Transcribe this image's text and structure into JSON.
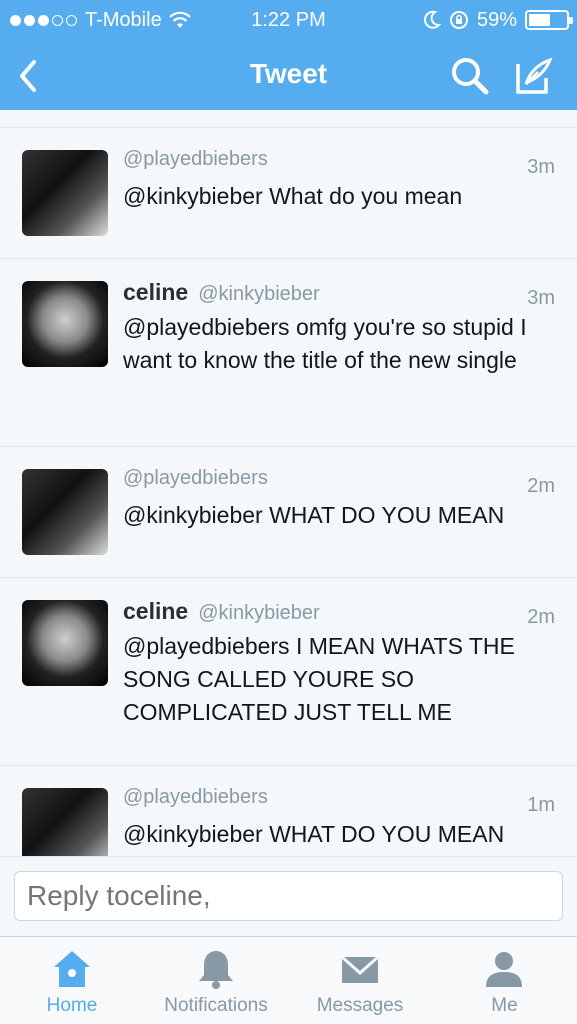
{
  "status": {
    "carrier": "T-Mobile",
    "time": "1:22 PM",
    "battery": "59%",
    "battery_level": 0.59
  },
  "nav": {
    "title": "Tweet",
    "back_icon": "chevron-left-icon",
    "search_icon": "search-icon",
    "compose_icon": "compose-icon"
  },
  "tweets": [
    {
      "name": "",
      "handle": "@playedbiebers",
      "time": "3m",
      "text": "@kinkybieber What do you mean",
      "avatar": "group"
    },
    {
      "name": "celine",
      "handle": "@kinkybieber",
      "time": "3m",
      "text": "@playedbiebers omfg you're so stupid I want to know the title of the new single",
      "avatar": "face"
    },
    {
      "name": "",
      "handle": "@playedbiebers",
      "time": "2m",
      "text": "@kinkybieber WHAT DO YOU MEAN",
      "avatar": "group"
    },
    {
      "name": "celine",
      "handle": "@kinkybieber",
      "time": "2m",
      "text": "@playedbiebers I MEAN WHATS THE SONG CALLED YOURE SO COMPLICATED JUST TELL ME",
      "avatar": "face"
    },
    {
      "name": "",
      "handle": "@playedbiebers",
      "time": "1m",
      "text": "@kinkybieber WHAT DO YOU MEAN",
      "avatar": "group"
    }
  ],
  "reply": {
    "placeholder": "Reply toceline,"
  },
  "tabs": [
    {
      "label": "Home",
      "icon": "home-icon",
      "active": true
    },
    {
      "label": "Notifications",
      "icon": "bell-icon",
      "active": false
    },
    {
      "label": "Messages",
      "icon": "envelope-icon",
      "active": false
    },
    {
      "label": "Me",
      "icon": "person-icon",
      "active": false
    }
  ],
  "colors": {
    "brand": "#55acee",
    "timeline_bg": "#f5f8fa",
    "muted": "#8899a6"
  }
}
